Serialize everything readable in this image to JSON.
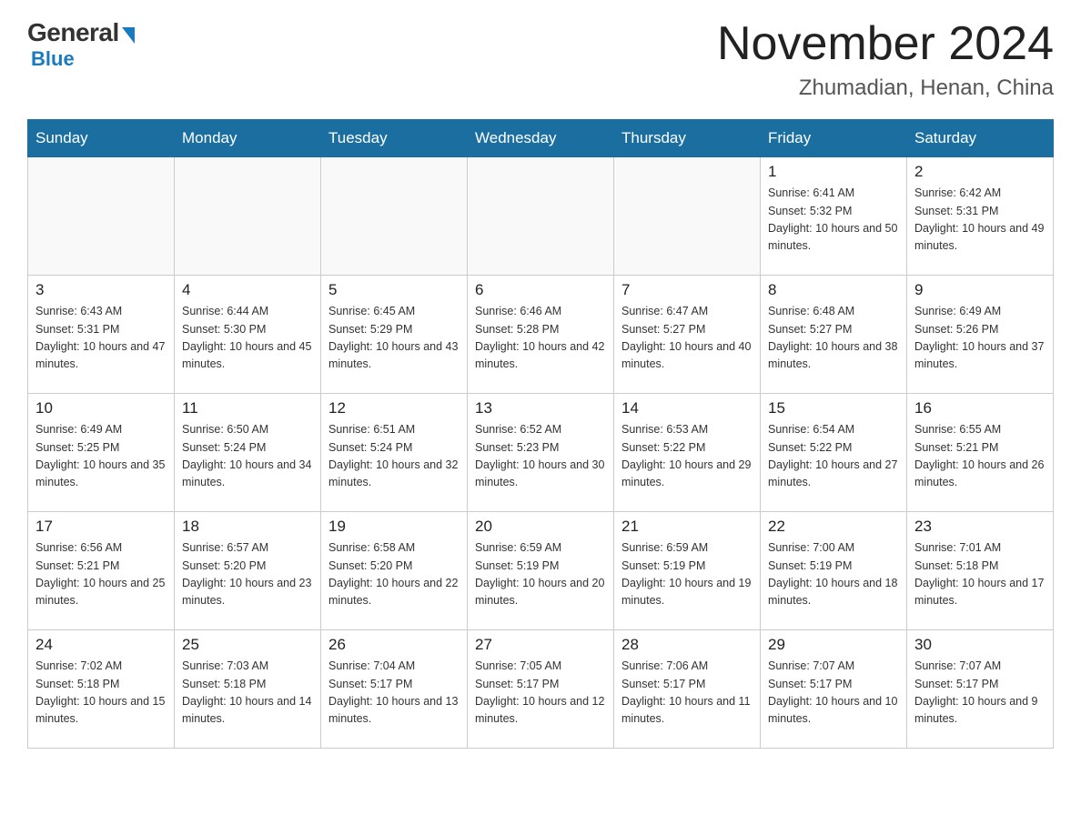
{
  "header": {
    "logo_general": "General",
    "logo_blue": "Blue",
    "month_title": "November 2024",
    "location": "Zhumadian, Henan, China"
  },
  "calendar": {
    "days_of_week": [
      "Sunday",
      "Monday",
      "Tuesday",
      "Wednesday",
      "Thursday",
      "Friday",
      "Saturday"
    ],
    "weeks": [
      [
        {
          "day": "",
          "info": ""
        },
        {
          "day": "",
          "info": ""
        },
        {
          "day": "",
          "info": ""
        },
        {
          "day": "",
          "info": ""
        },
        {
          "day": "",
          "info": ""
        },
        {
          "day": "1",
          "info": "Sunrise: 6:41 AM\nSunset: 5:32 PM\nDaylight: 10 hours and 50 minutes."
        },
        {
          "day": "2",
          "info": "Sunrise: 6:42 AM\nSunset: 5:31 PM\nDaylight: 10 hours and 49 minutes."
        }
      ],
      [
        {
          "day": "3",
          "info": "Sunrise: 6:43 AM\nSunset: 5:31 PM\nDaylight: 10 hours and 47 minutes."
        },
        {
          "day": "4",
          "info": "Sunrise: 6:44 AM\nSunset: 5:30 PM\nDaylight: 10 hours and 45 minutes."
        },
        {
          "day": "5",
          "info": "Sunrise: 6:45 AM\nSunset: 5:29 PM\nDaylight: 10 hours and 43 minutes."
        },
        {
          "day": "6",
          "info": "Sunrise: 6:46 AM\nSunset: 5:28 PM\nDaylight: 10 hours and 42 minutes."
        },
        {
          "day": "7",
          "info": "Sunrise: 6:47 AM\nSunset: 5:27 PM\nDaylight: 10 hours and 40 minutes."
        },
        {
          "day": "8",
          "info": "Sunrise: 6:48 AM\nSunset: 5:27 PM\nDaylight: 10 hours and 38 minutes."
        },
        {
          "day": "9",
          "info": "Sunrise: 6:49 AM\nSunset: 5:26 PM\nDaylight: 10 hours and 37 minutes."
        }
      ],
      [
        {
          "day": "10",
          "info": "Sunrise: 6:49 AM\nSunset: 5:25 PM\nDaylight: 10 hours and 35 minutes."
        },
        {
          "day": "11",
          "info": "Sunrise: 6:50 AM\nSunset: 5:24 PM\nDaylight: 10 hours and 34 minutes."
        },
        {
          "day": "12",
          "info": "Sunrise: 6:51 AM\nSunset: 5:24 PM\nDaylight: 10 hours and 32 minutes."
        },
        {
          "day": "13",
          "info": "Sunrise: 6:52 AM\nSunset: 5:23 PM\nDaylight: 10 hours and 30 minutes."
        },
        {
          "day": "14",
          "info": "Sunrise: 6:53 AM\nSunset: 5:22 PM\nDaylight: 10 hours and 29 minutes."
        },
        {
          "day": "15",
          "info": "Sunrise: 6:54 AM\nSunset: 5:22 PM\nDaylight: 10 hours and 27 minutes."
        },
        {
          "day": "16",
          "info": "Sunrise: 6:55 AM\nSunset: 5:21 PM\nDaylight: 10 hours and 26 minutes."
        }
      ],
      [
        {
          "day": "17",
          "info": "Sunrise: 6:56 AM\nSunset: 5:21 PM\nDaylight: 10 hours and 25 minutes."
        },
        {
          "day": "18",
          "info": "Sunrise: 6:57 AM\nSunset: 5:20 PM\nDaylight: 10 hours and 23 minutes."
        },
        {
          "day": "19",
          "info": "Sunrise: 6:58 AM\nSunset: 5:20 PM\nDaylight: 10 hours and 22 minutes."
        },
        {
          "day": "20",
          "info": "Sunrise: 6:59 AM\nSunset: 5:19 PM\nDaylight: 10 hours and 20 minutes."
        },
        {
          "day": "21",
          "info": "Sunrise: 6:59 AM\nSunset: 5:19 PM\nDaylight: 10 hours and 19 minutes."
        },
        {
          "day": "22",
          "info": "Sunrise: 7:00 AM\nSunset: 5:19 PM\nDaylight: 10 hours and 18 minutes."
        },
        {
          "day": "23",
          "info": "Sunrise: 7:01 AM\nSunset: 5:18 PM\nDaylight: 10 hours and 17 minutes."
        }
      ],
      [
        {
          "day": "24",
          "info": "Sunrise: 7:02 AM\nSunset: 5:18 PM\nDaylight: 10 hours and 15 minutes."
        },
        {
          "day": "25",
          "info": "Sunrise: 7:03 AM\nSunset: 5:18 PM\nDaylight: 10 hours and 14 minutes."
        },
        {
          "day": "26",
          "info": "Sunrise: 7:04 AM\nSunset: 5:17 PM\nDaylight: 10 hours and 13 minutes."
        },
        {
          "day": "27",
          "info": "Sunrise: 7:05 AM\nSunset: 5:17 PM\nDaylight: 10 hours and 12 minutes."
        },
        {
          "day": "28",
          "info": "Sunrise: 7:06 AM\nSunset: 5:17 PM\nDaylight: 10 hours and 11 minutes."
        },
        {
          "day": "29",
          "info": "Sunrise: 7:07 AM\nSunset: 5:17 PM\nDaylight: 10 hours and 10 minutes."
        },
        {
          "day": "30",
          "info": "Sunrise: 7:07 AM\nSunset: 5:17 PM\nDaylight: 10 hours and 9 minutes."
        }
      ]
    ]
  }
}
